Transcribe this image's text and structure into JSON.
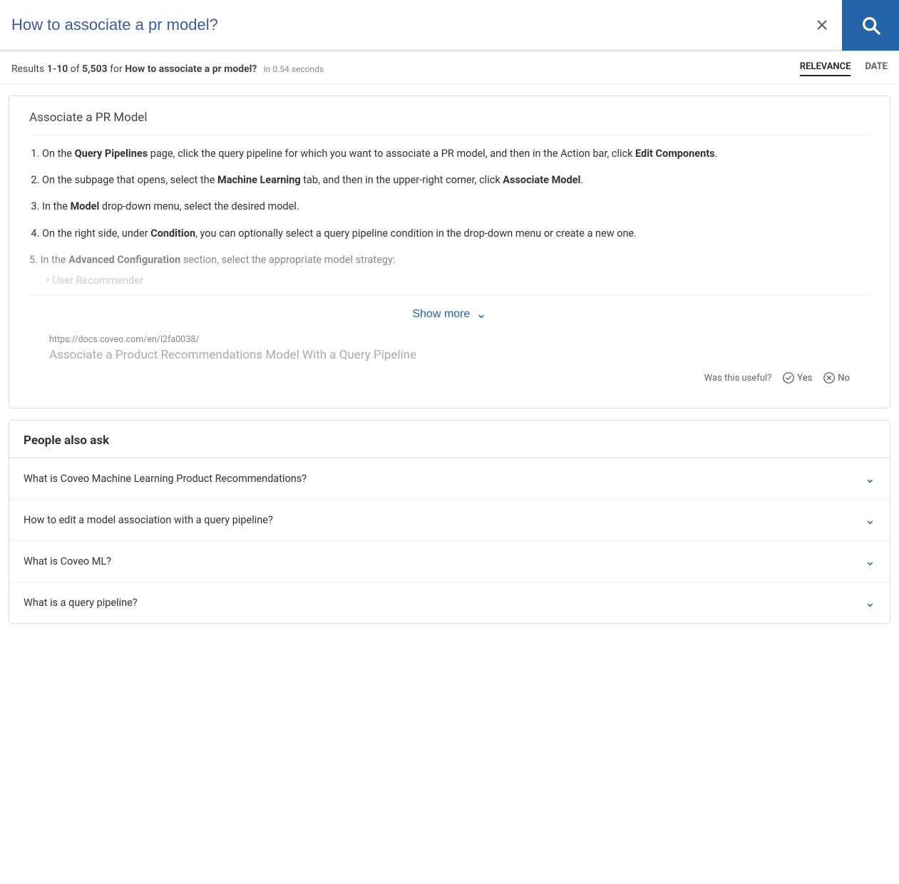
{
  "search": {
    "query": "How to associate a pr model?",
    "clear_label": "×",
    "search_icon_label": "search"
  },
  "results_meta": {
    "prefix": "Results ",
    "range": "1-10",
    "of_text": " of ",
    "count": "5,503",
    "for_text": " for ",
    "query_bold": "How to associate a pr model?",
    "time_text": "in 0.54 seconds"
  },
  "sort": {
    "options": [
      {
        "label": "RELEVANCE",
        "active": true
      },
      {
        "label": "DATE",
        "active": false
      }
    ]
  },
  "featured": {
    "title": "Associate a PR Model",
    "steps": [
      {
        "num": "1.",
        "text_before": "On the ",
        "bold1": "Query Pipelines",
        "text_middle": " page, click the query pipeline for which you want to associate a PR model, and then in the Action bar, click ",
        "bold2": "Edit Components",
        "text_after": "."
      },
      {
        "num": "2.",
        "text_before": "On the subpage that opens, select the ",
        "bold1": "Machine Learning",
        "text_middle": " tab, and then in the upper-right corner, click ",
        "bold2": "Associate Model",
        "text_after": "."
      },
      {
        "num": "3.",
        "text_before": "In the ",
        "bold1": "Model",
        "text_middle": " drop-down menu, select the desired model.",
        "bold2": "",
        "text_after": ""
      },
      {
        "num": "4.",
        "text_before": "On the right side, under ",
        "bold1": "Condition",
        "text_middle": ", you can optionally select a query pipeline condition in the drop-down menu or create a new one.",
        "bold2": "",
        "text_after": ""
      }
    ],
    "step5_text": "5. In the ",
    "step5_bold": "Advanced Configuration",
    "step5_after": " section, select the appropriate model strategy:",
    "sub_item": "User Recommender",
    "show_more_label": "Show more"
  },
  "result_link": {
    "url": "https://docs.coveo.com/en/l2fa0038/",
    "title": "Associate a Product Recommendations Model With a Query Pipeline"
  },
  "feedback": {
    "question": "Was this useful?",
    "yes_label": "Yes",
    "no_label": "No"
  },
  "paa": {
    "header": "People also ask",
    "items": [
      {
        "question": "What is Coveo Machine Learning Product Recommendations?"
      },
      {
        "question": "How to edit a model association with a query pipeline?"
      },
      {
        "question": "What is Coveo ML?"
      },
      {
        "question": "What is a query pipeline?"
      }
    ]
  }
}
